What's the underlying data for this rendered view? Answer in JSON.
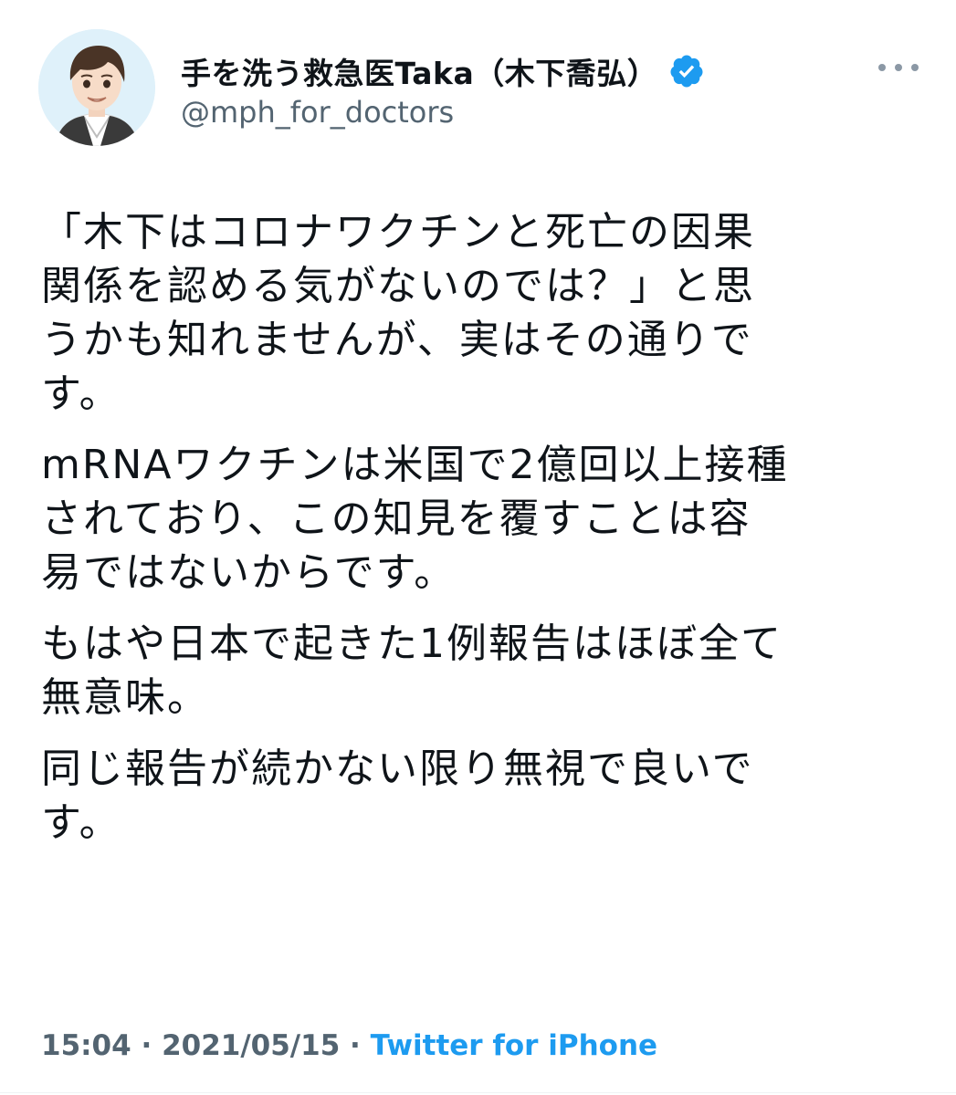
{
  "tweet": {
    "author": {
      "display_name": "手を洗う救急医Taka（木下喬弘）",
      "handle": "@mph_for_doctors",
      "verified": true,
      "avatar_icon": "illustrated-portrait-avatar"
    },
    "more_icon": "more-horizontal-icon",
    "paragraphs": [
      "「木下はコロナワクチンと死亡の因果\n関係を認める気がないのでは？」と思\nうかも知れませんが、実はその通りで\nす。",
      "mRNAワクチンは米国で2億回以上接種\nされており、この知見を覆すことは容\n易ではないからです。",
      "もはや日本で起きた1例報告はほぼ全て\n無意味。",
      "同じ報告が続かない限り無視で良いで\nす。"
    ],
    "time": "15:04",
    "separator": " · ",
    "date": "2021/05/15",
    "source": "Twitter for iPhone"
  },
  "colors": {
    "text": "#0f1419",
    "secondary": "#536471",
    "link": "#1d9bf0",
    "verified": "#1d9bf0"
  }
}
